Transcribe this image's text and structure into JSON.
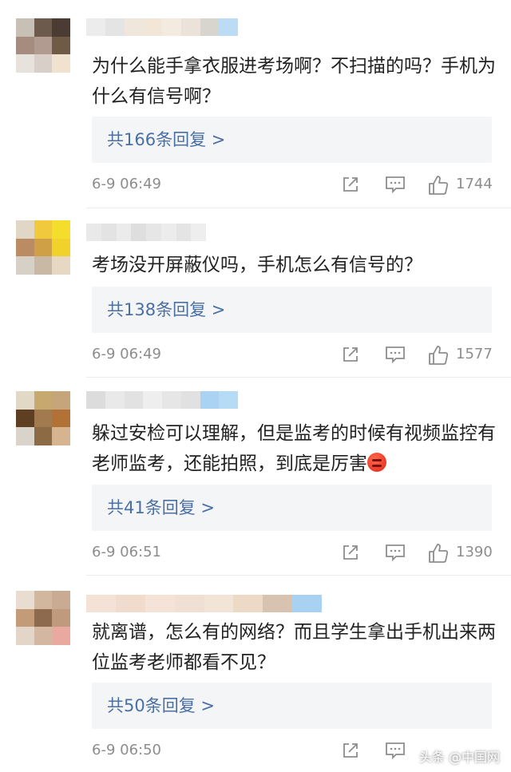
{
  "comments": [
    {
      "text": "为什么能手拿衣服进考场啊？不扫描的吗？手机为什么有信号啊？",
      "replies": "共166条回复 >",
      "time": "6-9 06:49",
      "likes": "1744",
      "avatar_colors": [
        "#c9c0b5",
        "#6c5a4d",
        "#4a3c33",
        "#a58c7f",
        "#b19a8f",
        "#6f5a45",
        "#e7e2db",
        "#d7cfc8",
        "#f1e2cf"
      ],
      "name_colors": [
        "#ececec",
        "#e4e4e4",
        "#efe6dc",
        "#f1e6d8",
        "#f3eae0",
        "#ebe3d9",
        "#d8d4ce",
        "#bcdcf5"
      ]
    },
    {
      "text": "考场没开屏蔽仪吗，手机怎么有信号的？",
      "replies": "共138条回复 >",
      "time": "6-9 06:49",
      "likes": "1577",
      "avatar_colors": [
        "#e0d7c7",
        "#f0c93c",
        "#f4dd2b",
        "#bb8c63",
        "#cfa046",
        "#f1d22b",
        "#d6d0c6",
        "#c9b8a4",
        "#e7d8c3"
      ],
      "name_colors": [
        "#e9e9e9",
        "#e3e3e3",
        "#ebebeb",
        "#dedede",
        "#e6e6e6",
        "#ececec",
        "#e4e4e4",
        "#eeeeee"
      ]
    },
    {
      "text": "躲过安检可以理解，但是监考的时候有视频监控有老师监考，还能拍照，到底是厉害",
      "replies": "共41条回复 >",
      "time": "6-9 06:51",
      "likes": "1390",
      "avatar_colors": [
        "#e2d8c6",
        "#c7a86f",
        "#c6a57a",
        "#5e3f22",
        "#a27a4f",
        "#b27235",
        "#d9d3c9",
        "#8c6a44",
        "#d6b48f"
      ],
      "name_colors": [
        "#dcdcdc",
        "#e9e9e9",
        "#e2e2e2",
        "#eeeeee",
        "#e6e6e6",
        "#e1e1e1",
        "#a9d2f3",
        "#b6dbf6"
      ]
    },
    {
      "text": "就离谱，怎么有的网络？而且学生拿出手机出来两位监考老师都看不见？",
      "replies": "共50条回复 >",
      "time": "6-9 06:50",
      "likes": "",
      "avatar_colors": [
        "#e8ddd0",
        "#d1b79e",
        "#c9ab91",
        "#c49b79",
        "#8d6a4e",
        "#bf9a7d",
        "#e3d6c9",
        "#d4b7a0",
        "#e9a8a0"
      ],
      "name_colors": [
        "#f5e2d6",
        "#f1dbcc",
        "#f4e3d6",
        "#efe0d3",
        "#f2e4d6",
        "#ecd9c6",
        "#d8c3b0",
        "#a9d1f2"
      ]
    }
  ],
  "watermark": "头条 @中国网"
}
